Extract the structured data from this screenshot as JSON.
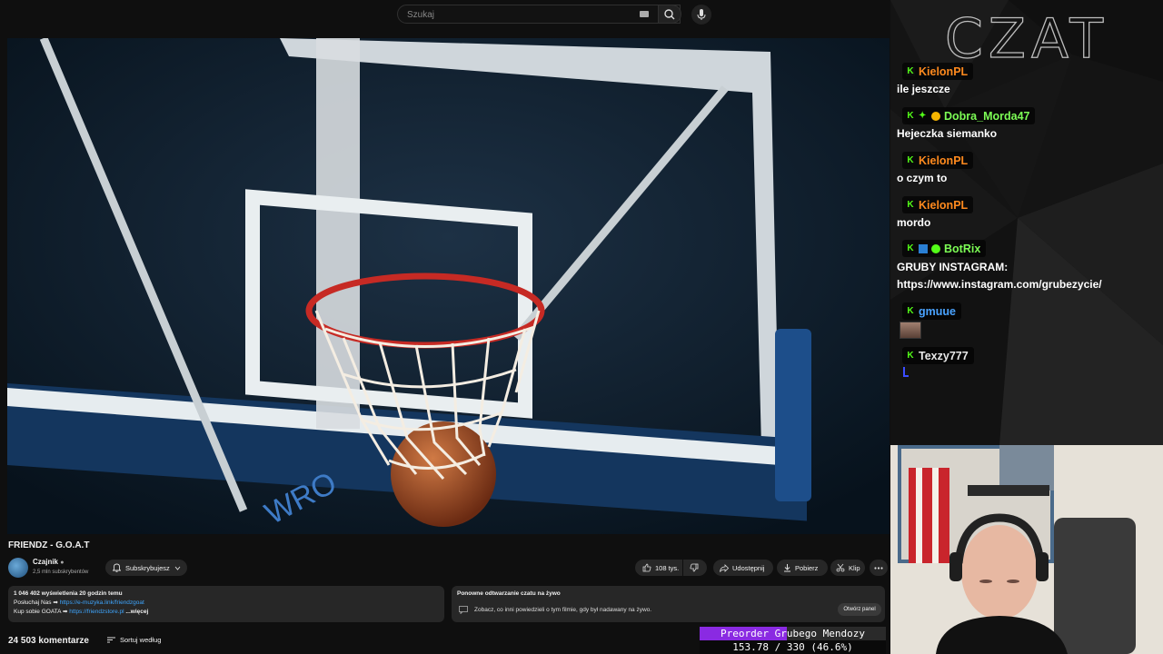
{
  "search": {
    "placeholder": "Szukaj"
  },
  "video": {
    "title": "FRIENDZ - G.O.A.T"
  },
  "channel": {
    "name": "Czajnik",
    "subscribers": "2,5 mln subskrybentów",
    "subscribe_label": "Subskrybujesz"
  },
  "actions": {
    "likes": "108 tys.",
    "share": "Udostępnij",
    "download": "Pobierz",
    "clip": "Klip"
  },
  "description": {
    "stats": "1 046 402 wyświetlenia  20 godzin temu",
    "line1_prefix": "Posłuchaj Nas ➡ ",
    "line1_link": "https://e-muzyka.link/friendzgoat",
    "line2_prefix": "Kup sobie GOATA ➡ ",
    "line2_link": "https://friendzstore.pl",
    "more": "...więcej"
  },
  "replay": {
    "title": "Ponowne odtwarzanie czatu na żywo",
    "text": "Zobacz, co inni powiedzieli o tym filmie, gdy był nadawany na żywo.",
    "button": "Otwórz panel"
  },
  "comments": {
    "count_label": "24 503 komentarze",
    "sort_label": "Sortuj według"
  },
  "chat": {
    "header": "CZAT",
    "messages": [
      {
        "user": "KielonPL",
        "text": "ile jeszcze",
        "color": "#ff8a1e"
      },
      {
        "user": "Dobra_Morda47",
        "text": "Hejeczka siemanko",
        "color": "#7cfc55"
      },
      {
        "user": "KielonPL",
        "text": "o czym to",
        "color": "#ff8a1e"
      },
      {
        "user": "KielonPL",
        "text": "mordo",
        "color": "#ff8a1e"
      },
      {
        "user": "BotRix",
        "text": "GRUBY INSTAGRAM:",
        "text2": "https://www.instagram.com/grubezycie/",
        "color": "#7cfc55"
      },
      {
        "user": "gmuue",
        "text": "",
        "color": "#4aa3ff"
      },
      {
        "user": "Texzy777",
        "text": "",
        "color": "#e8e8e8"
      }
    ]
  },
  "goal": {
    "title": "Preorder Grubego Mendozy",
    "value_label": "153.78 / 330 (46.6%)",
    "current": 153.78,
    "target": 330,
    "percent": 46.6
  },
  "colors": {
    "kick_green": "#53fc18",
    "goal_purple": "#8a2ae2",
    "link_blue": "#3ea6ff"
  }
}
